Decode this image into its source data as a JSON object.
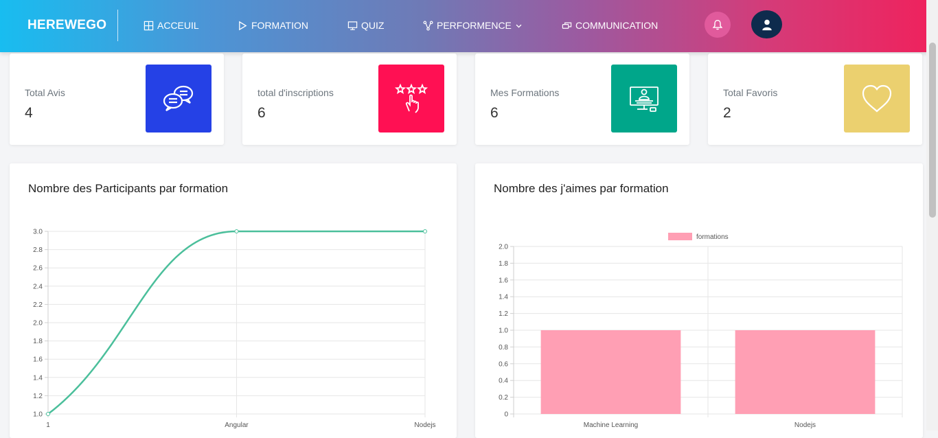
{
  "brand": "HEREWEGO",
  "nav": {
    "items": [
      {
        "label": "ACCEUIL",
        "icon": "dashboard-icon"
      },
      {
        "label": "FORMATION",
        "icon": "play-icon"
      },
      {
        "label": "QUIZ",
        "icon": "monitor-icon"
      },
      {
        "label": "PERFORMENCE",
        "icon": "network-icon"
      },
      {
        "label": "COMMUNICATION",
        "icon": "chat-bubbles-icon"
      }
    ],
    "bell_icon": "bell-icon",
    "user_icon": "user-icon"
  },
  "stats": [
    {
      "label": "Total Avis",
      "value": "4",
      "color": "#2541e6",
      "icon": "chat-bubbles-icon"
    },
    {
      "label": "total d'inscriptions",
      "value": "6",
      "color": "#ff1053",
      "icon": "stars-hand-icon"
    },
    {
      "label": "Mes Formations",
      "value": "6",
      "color": "#00a68a",
      "icon": "computer-training-icon"
    },
    {
      "label": "Total Favoris",
      "value": "2",
      "color": "#ebd06f",
      "icon": "heart-icon"
    }
  ],
  "charts": {
    "participants_title": "Nombre des Participants par formation",
    "likes_title": "Nombre des j'aimes par formation"
  },
  "chart_data": [
    {
      "type": "line",
      "title": "Nombre des Participants par formation",
      "categories": [
        "1",
        "Angular",
        "Nodejs"
      ],
      "series": [
        {
          "values": [
            1,
            3,
            3
          ]
        }
      ],
      "ylim": [
        1.0,
        3.0
      ],
      "yticks": [
        "3.0",
        "2.8",
        "2.6",
        "2.4",
        "2.2",
        "2.0",
        "1.8",
        "1.6",
        "1.4",
        "1.2",
        "1.0"
      ],
      "color": "#4bbf9b",
      "grid": true
    },
    {
      "type": "bar",
      "title": "Nombre des j'aimes par formation",
      "categories": [
        "Machine Learning",
        "Nodejs"
      ],
      "series": [
        {
          "name": "formations",
          "values": [
            1,
            1
          ]
        }
      ],
      "ylim": [
        0,
        2.0
      ],
      "yticks": [
        "2.0",
        "1.8",
        "1.6",
        "1.4",
        "1.2",
        "1.0",
        "0.8",
        "0.6",
        "0.4",
        "0.2",
        "0"
      ],
      "color": "#ff9fb4",
      "legend": "top",
      "grid": true
    }
  ]
}
